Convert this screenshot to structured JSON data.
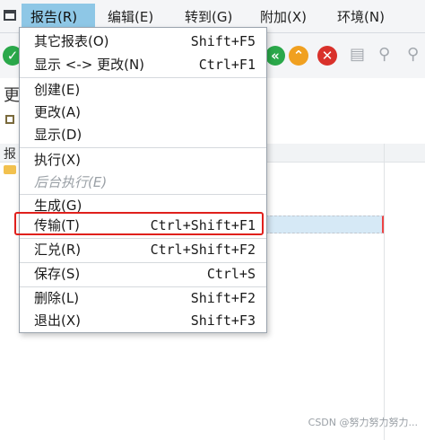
{
  "menubar": {
    "menus": [
      {
        "label": "报告(R)"
      },
      {
        "label": "编辑(E)"
      },
      {
        "label": "转到(G)"
      },
      {
        "label": "附加(X)"
      },
      {
        "label": "环境(N)"
      }
    ],
    "active_index": 0
  },
  "dropdown": {
    "items": [
      {
        "label": "其它报表(O)",
        "shortcut": "Shift+F5",
        "enabled": true
      },
      {
        "label": "显示 <-> 更改(N)",
        "shortcut": "Ctrl+F1",
        "enabled": true
      },
      {
        "label": "创建(E)",
        "shortcut": "",
        "enabled": true
      },
      {
        "label": "更改(A)",
        "shortcut": "",
        "enabled": true
      },
      {
        "label": "显示(D)",
        "shortcut": "",
        "enabled": true
      },
      {
        "label": "执行(X)",
        "shortcut": "",
        "enabled": true
      },
      {
        "label": "后台执行(E)",
        "shortcut": "",
        "enabled": false
      },
      {
        "label": "生成(G)",
        "shortcut": "",
        "enabled": true
      },
      {
        "label": "传输(T)",
        "shortcut": "Ctrl+Shift+F1",
        "enabled": true,
        "highlighted": true
      },
      {
        "label": "汇兑(R)",
        "shortcut": "Ctrl+Shift+F2",
        "enabled": true
      },
      {
        "label": "保存(S)",
        "shortcut": "Ctrl+S",
        "enabled": true
      },
      {
        "label": "删除(L)",
        "shortcut": "Shift+F2",
        "enabled": true
      },
      {
        "label": "退出(X)",
        "shortcut": "Shift+F3",
        "enabled": true
      }
    ]
  },
  "background": {
    "fragment_1": "更",
    "tree_header": "报"
  },
  "toolbar": {
    "icons": [
      "check-icon",
      "nav-left-icon",
      "nav-up-icon",
      "cancel-icon",
      "print-icon",
      "find-icon",
      "find-next-icon"
    ]
  },
  "colors": {
    "active_menu": "#8ec7e6",
    "highlight_border": "#e0201c",
    "check_green": "#2aa84a",
    "cancel_red": "#d9312b",
    "nav_orange": "#f0a020"
  },
  "watermark": "CSDN @努力努力努力..."
}
